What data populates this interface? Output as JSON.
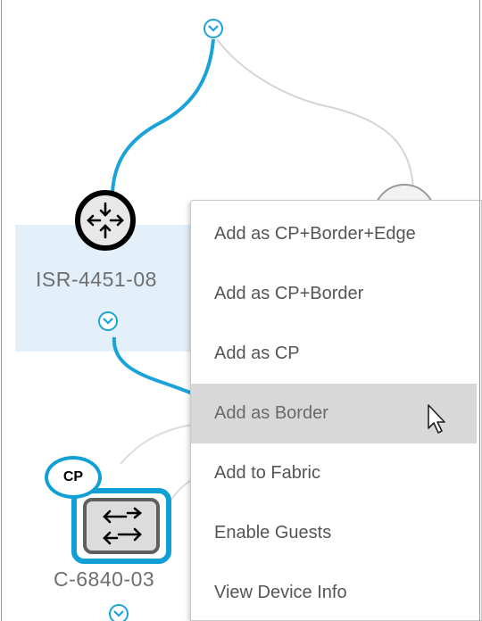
{
  "topology": {
    "router_label": "ISR-4451-08",
    "switch_label": "C-6840-03",
    "cp_badge": "CP"
  },
  "context_menu": {
    "items": [
      {
        "label": "Add as CP+Border+Edge",
        "hovered": false
      },
      {
        "label": "Add as CP+Border",
        "hovered": false
      },
      {
        "label": "Add as CP",
        "hovered": false
      },
      {
        "label": "Add as Border",
        "hovered": true
      },
      {
        "label": "Add to Fabric",
        "hovered": false
      },
      {
        "label": "Enable Guests",
        "hovered": false
      },
      {
        "label": "View Device Info",
        "hovered": false
      }
    ]
  },
  "icons": {
    "expand": "chevron-down-icon",
    "router": "router-arrows-icon",
    "switch": "switch-arrows-icon",
    "cursor": "mouse-pointer-icon"
  },
  "colors": {
    "accent": "#1aa3d9",
    "highlight": "#e3eff9",
    "menu_hover": "#d8d8d8",
    "text": "#555555"
  }
}
